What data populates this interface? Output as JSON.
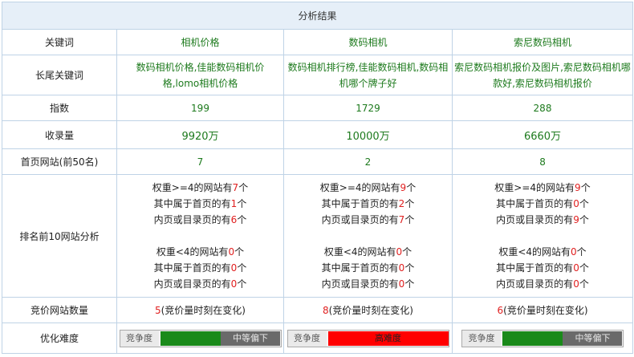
{
  "title": "分析结果",
  "labels": {
    "keyword": "关键词",
    "longtail": "长尾关键词",
    "index": "指数",
    "indexed": "收录量",
    "homesites": "首页网站(前50名)",
    "top10": "排名前10网站分析",
    "bidcount": "竞价网站数量",
    "difficulty": "优化难度"
  },
  "analysis_template": {
    "w_ge4": "权重>=4的网站有",
    "w_lt4": "权重<4的网站有",
    "home": "其中属于首页的有",
    "inner": "内页或目录页的有",
    "unit": "个"
  },
  "bid_note": "(竞价量时刻在变化)",
  "difficulty_label": "竞争度",
  "columns": [
    {
      "keyword": "相机价格",
      "longtail": "数码相机价格,佳能数码相机价格,lomo相机价格",
      "index": "199",
      "indexed": "9920万",
      "homesites": "7",
      "a": {
        "w_ge4": "7",
        "home1": "1",
        "inner1": "6",
        "w_lt4": "0",
        "home2": "0",
        "inner2": "0"
      },
      "bid": "5",
      "difficulty": {
        "text": "中等偏下",
        "level": 0.5,
        "color": "#1a8a1a"
      }
    },
    {
      "keyword": "数码相机",
      "longtail": "数码相机排行榜,佳能数码相机,数码相机哪个牌子好",
      "index": "1729",
      "indexed": "10000万",
      "homesites": "2",
      "a": {
        "w_ge4": "9",
        "home1": "2",
        "inner1": "7",
        "w_lt4": "0",
        "home2": "0",
        "inner2": "0"
      },
      "bid": "8",
      "difficulty": {
        "text": "高难度",
        "level": 1.0,
        "color": "#ff0000"
      }
    },
    {
      "keyword": "索尼数码相机",
      "longtail": "索尼数码相机报价及图片,索尼数码相机哪款好,索尼数码相机报价",
      "index": "288",
      "indexed": "6660万",
      "homesites": "8",
      "a": {
        "w_ge4": "9",
        "home1": "0",
        "inner1": "9",
        "w_lt4": "0",
        "home2": "0",
        "inner2": "0"
      },
      "bid": "6",
      "difficulty": {
        "text": "中等偏下",
        "level": 0.5,
        "color": "#1a8a1a"
      }
    }
  ]
}
